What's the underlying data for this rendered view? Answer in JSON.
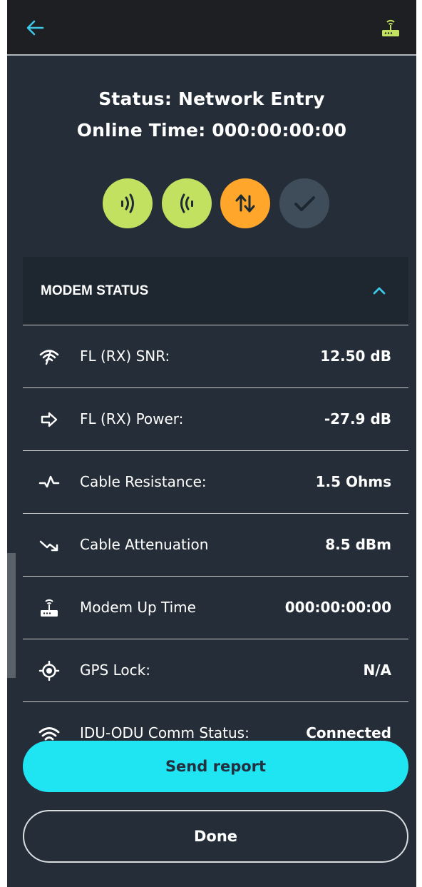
{
  "header": {
    "back_icon": "arrow-left-icon",
    "device_icon": "modem-icon",
    "colors": {
      "accent": "#3ec8e8",
      "device": "#c3e160"
    }
  },
  "status": {
    "title": "Status: Network Entry",
    "online_time": "Online Time: 000:00:00:00"
  },
  "indicators": [
    {
      "icon": "signal-out-icon",
      "color": "#c3e160"
    },
    {
      "icon": "signal-in-icon",
      "color": "#c3e160"
    },
    {
      "icon": "up-down-arrows-icon",
      "color": "#ffa62b"
    },
    {
      "icon": "checkmark-icon",
      "color": "#3f4d5a"
    }
  ],
  "modem_status": {
    "title": "MODEM STATUS",
    "collapse_icon": "chevron-up-icon",
    "rows": [
      {
        "icon": "signal-snr-icon",
        "label": "FL (RX) SNR:",
        "value": "12.50 dB"
      },
      {
        "icon": "arrow-right-icon",
        "label": "FL (RX) Power:",
        "value": "-27.9 dB"
      },
      {
        "icon": "pulse-icon",
        "label": "Cable Resistance:",
        "value": "1.5 Ohms"
      },
      {
        "icon": "trend-down-icon",
        "label": "Cable Attenuation",
        "value": "8.5 dBm"
      },
      {
        "icon": "modem-icon",
        "label": "Modem Up Time",
        "value": "000:00:00:00"
      },
      {
        "icon": "gps-target-icon",
        "label": "GPS Lock:",
        "value": "N/A"
      },
      {
        "icon": "wifi-icon",
        "label": "IDU-ODU Comm Status:",
        "value": "Connected"
      }
    ]
  },
  "actions": {
    "send_label": "Send report",
    "done_label": "Done"
  }
}
